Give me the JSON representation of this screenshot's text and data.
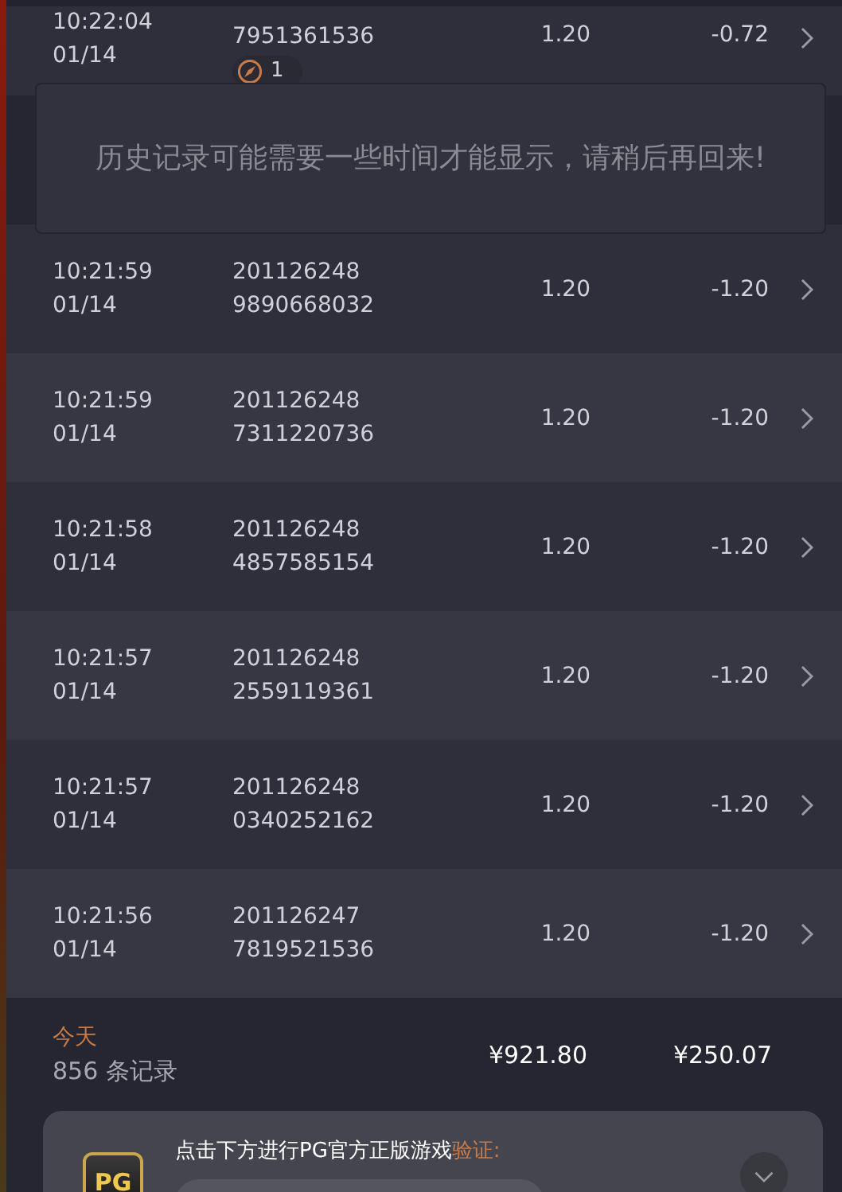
{
  "rows": [
    {
      "time": "10:22:04",
      "date": "01/14",
      "id_lines": [
        "7951361536"
      ],
      "bet": "1.20",
      "profit": "-0.72",
      "badge": "1"
    },
    {
      "time": "10:21:59",
      "date": "01/14",
      "id_lines": [
        "201126248",
        "9890668032"
      ],
      "bet": "1.20",
      "profit": "-1.20"
    },
    {
      "time": "10:21:59",
      "date": "01/14",
      "id_lines": [
        "201126248",
        "7311220736"
      ],
      "bet": "1.20",
      "profit": "-1.20"
    },
    {
      "time": "10:21:58",
      "date": "01/14",
      "id_lines": [
        "201126248",
        "4857585154"
      ],
      "bet": "1.20",
      "profit": "-1.20"
    },
    {
      "time": "10:21:57",
      "date": "01/14",
      "id_lines": [
        "201126248",
        "2559119361"
      ],
      "bet": "1.20",
      "profit": "-1.20"
    },
    {
      "time": "10:21:57",
      "date": "01/14",
      "id_lines": [
        "201126248",
        "0340252162"
      ],
      "bet": "1.20",
      "profit": "-1.20"
    },
    {
      "time": "10:21:56",
      "date": "01/14",
      "id_lines": [
        "201126247",
        "7819521536"
      ],
      "bet": "1.20",
      "profit": "-1.20"
    }
  ],
  "toast": "历史记录可能需要一些时间才能显示，请稍后再回来!",
  "summary": {
    "period": "今天",
    "count": "856 条记录",
    "total_bet": "¥921.80",
    "total_profit": "¥250.07"
  },
  "verify_card": {
    "logo": "PG",
    "text": "点击下方进行PG官方正版游戏",
    "highlight": "验证:"
  }
}
